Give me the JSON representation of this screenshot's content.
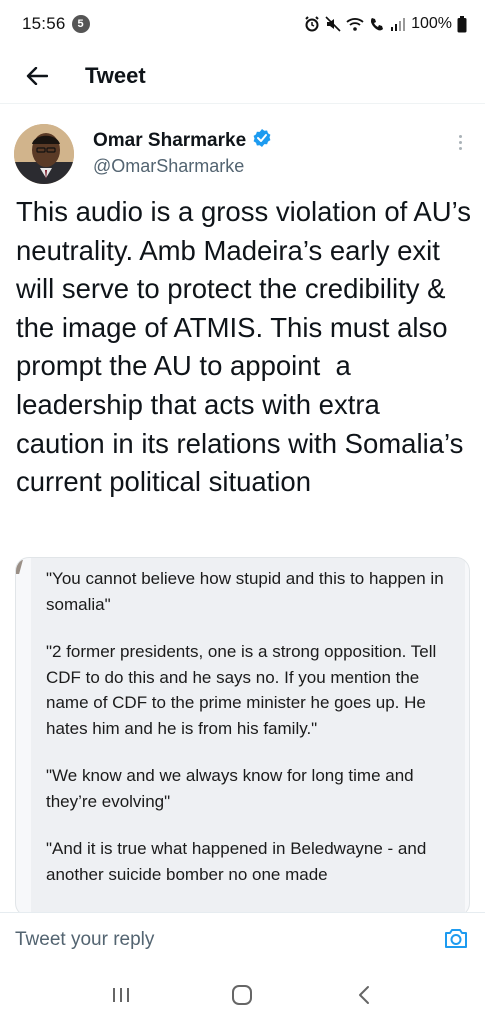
{
  "status_bar": {
    "time": "15:56",
    "notification_count": "5",
    "battery": "100%"
  },
  "header": {
    "title": "Tweet",
    "back_icon": "arrow-left-icon"
  },
  "author": {
    "name": "Omar Sharmarke",
    "handle": "@OmarSharmarke",
    "verified": true,
    "verified_color": "#1d9bf0"
  },
  "tweet": {
    "text": "This audio is a gross violation of AU’s neutrality. Amb Madeira’s early exit will serve to protect the credibility & the image of ATMIS. This must also prompt the AU to appoint  a leadership that acts with extra caution in its relations with Somalia’s current political situation"
  },
  "media": {
    "paragraphs": [
      "\"You cannot believe how stupid and this to happen in somalia\"",
      "\"2 former presidents, one is a strong opposition. Tell CDF to do this and he says no. If you mention the name of CDF to the prime minister he goes up. He hates him and he is from his family.\"",
      "\"We know and we always know for long time and they’re evolving\"",
      "\"And it is true what happened in Beledwayne - and another suicide bomber no one made"
    ]
  },
  "reply": {
    "placeholder": "Tweet your reply",
    "accent": "#1d9bf0"
  },
  "nav": {
    "icons": [
      "recents-icon",
      "home-icon",
      "back-icon"
    ]
  }
}
